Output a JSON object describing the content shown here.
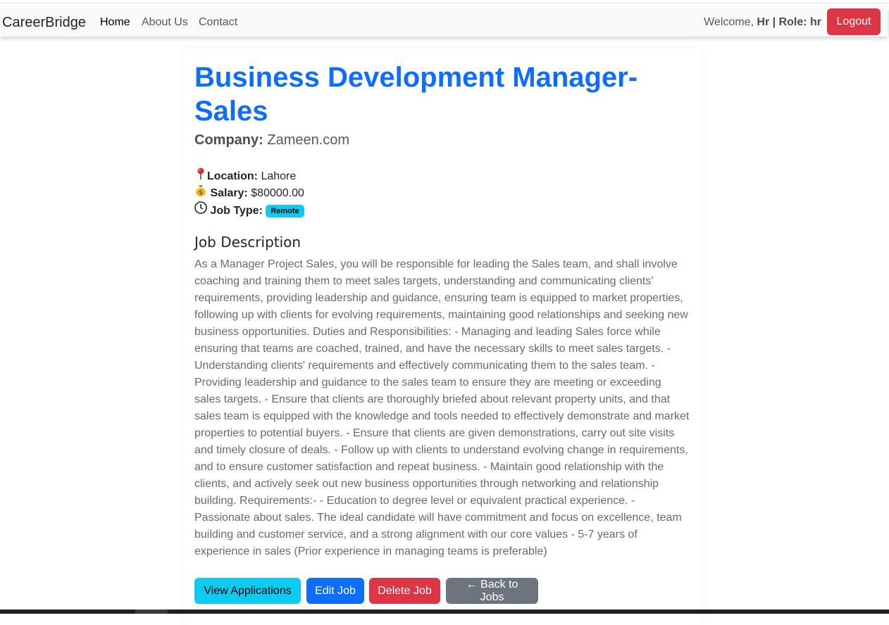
{
  "navbar": {
    "brand": "CareerBridge",
    "links": [
      "Home",
      "About Us",
      "Contact"
    ],
    "welcome_prefix": "Welcome, ",
    "user_name": "Hr",
    "separator": " | ",
    "role_label": "Role:",
    "role_value": " hr",
    "logout_label": "Logout"
  },
  "job": {
    "title": "Business Development Manager-Sales",
    "company_label": "Company:",
    "company_name": " Zameen.com",
    "location_label": "Location:",
    "location_value": " Lahore",
    "salary_label": "Salary:",
    "salary_value": " $80000.00",
    "job_type_label": "Job Type:",
    "job_type_value": "Remote",
    "description_heading": "Job Description",
    "description": "As a Manager Project Sales, you will be responsible for leading the Sales team, and shall involve coaching and training them to meet sales targets, understanding and communicating clients' requirements, providing leadership and guidance, ensuring team is equipped to market properties, following up with clients for evolving requirements, maintaining good relationships and seeking new business opportunities. Duties and Responsibilities: - Managing and leading Sales force while ensuring that teams are coached, trained, and have the necessary skills to meet sales targets. - Understanding clients' requirements and effectively communicating them to the sales team. - Providing leadership and guidance to the sales team to ensure they are meeting or exceeding sales targets. - Ensure that clients are thoroughly briefed about relevant property units, and that sales team is equipped with the knowledge and tools needed to effectively demonstrate and market properties to potential buyers. - Ensure that clients are given demonstrations, carry out site visits and timely closure of deals. - Follow up with clients to understand evolving change in requirements, and to ensure customer satisfaction and repeat business. - Maintain good relationship with the clients, and actively seek out new business opportunities through networking and relationship building. Requirements:- - Education to degree level or equivalent practical experience. - Passionate about sales. The ideal candidate will have commitment and focus on excellence, team building and customer service, and a strong alignment with our core values - 5-7 years of experience in sales (Prior experience in managing teams is preferable)"
  },
  "actions": {
    "view_applications": "View Applications",
    "edit_job": "Edit Job",
    "delete_job": "Delete Job",
    "back_to_jobs": "← Back to Jobs"
  },
  "icons": {
    "location": "pin-icon",
    "salary": "money-bag-icon",
    "job_type": "clock-icon"
  },
  "colors": {
    "primary": "#0d6efd",
    "danger": "#dc3545",
    "info": "#0dcaf0",
    "secondary": "#6c757d"
  }
}
